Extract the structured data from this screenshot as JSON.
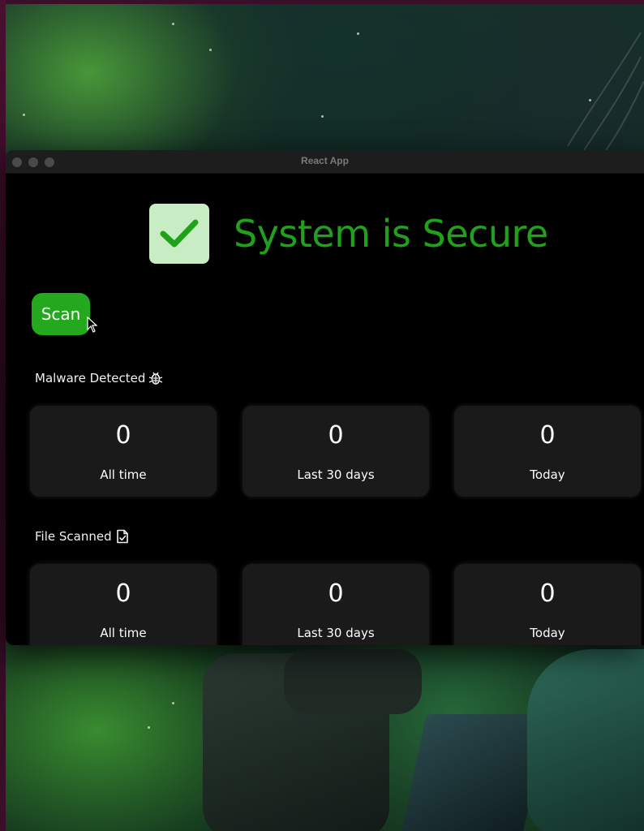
{
  "window": {
    "title": "React App"
  },
  "status": {
    "title": "System is Secure",
    "icon": "checkmark-icon",
    "color": "#1fa21a"
  },
  "scan_button": {
    "label": "Scan",
    "color": "#23a81e"
  },
  "malware": {
    "label": "Malware Detected",
    "icon": "bug-icon",
    "cards": [
      {
        "value": "0",
        "label": "All time"
      },
      {
        "value": "0",
        "label": "Last 30 days"
      },
      {
        "value": "0",
        "label": "Today"
      }
    ]
  },
  "files": {
    "label": "File Scanned",
    "icon": "file-check-icon",
    "cards": [
      {
        "value": "0",
        "label": "All time"
      },
      {
        "value": "0",
        "label": "Last 30 days"
      },
      {
        "value": "0",
        "label": "Today"
      }
    ]
  }
}
